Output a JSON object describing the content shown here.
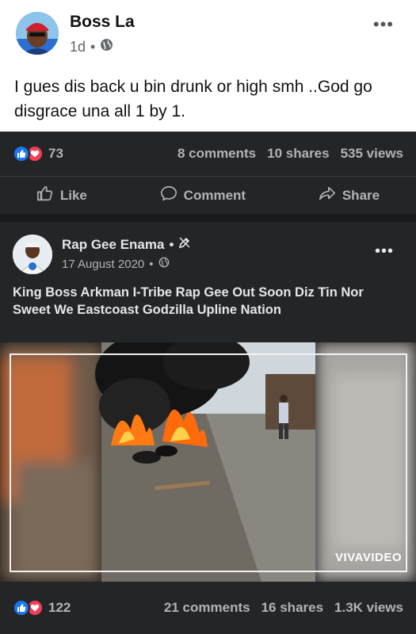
{
  "post": {
    "author": "Boss La",
    "time": "1d",
    "separator": "•",
    "text": "I gues dis back u bin drunk or high smh ..God go disgrace una all 1 by 1.",
    "reactions_count": "73",
    "comments": "8 comments",
    "shares": "10 shares",
    "views": "535 views"
  },
  "actions": {
    "like": "Like",
    "comment": "Comment",
    "share": "Share"
  },
  "shared_post": {
    "author": "Rap Gee Enama",
    "separator": "•",
    "date": "17 August 2020",
    "text": "King Boss Arkman I-Tribe Rap Gee Out Soon Diz Tin Nor Sweet We Eastcoast Godzilla Upline Nation",
    "watermark": "VIVAVIDEO",
    "reactions_count": "122",
    "comments": "21 comments",
    "shares": "16 shares",
    "views": "1.3K views"
  },
  "icons": [
    "globe-icon",
    "like-icon",
    "love-icon",
    "comment-icon",
    "share-icon",
    "more-icon",
    "edit-icon"
  ],
  "colors": {
    "like_blue": "#1877f2",
    "love_red": "#f33e58",
    "dark_bg": "#242526"
  }
}
